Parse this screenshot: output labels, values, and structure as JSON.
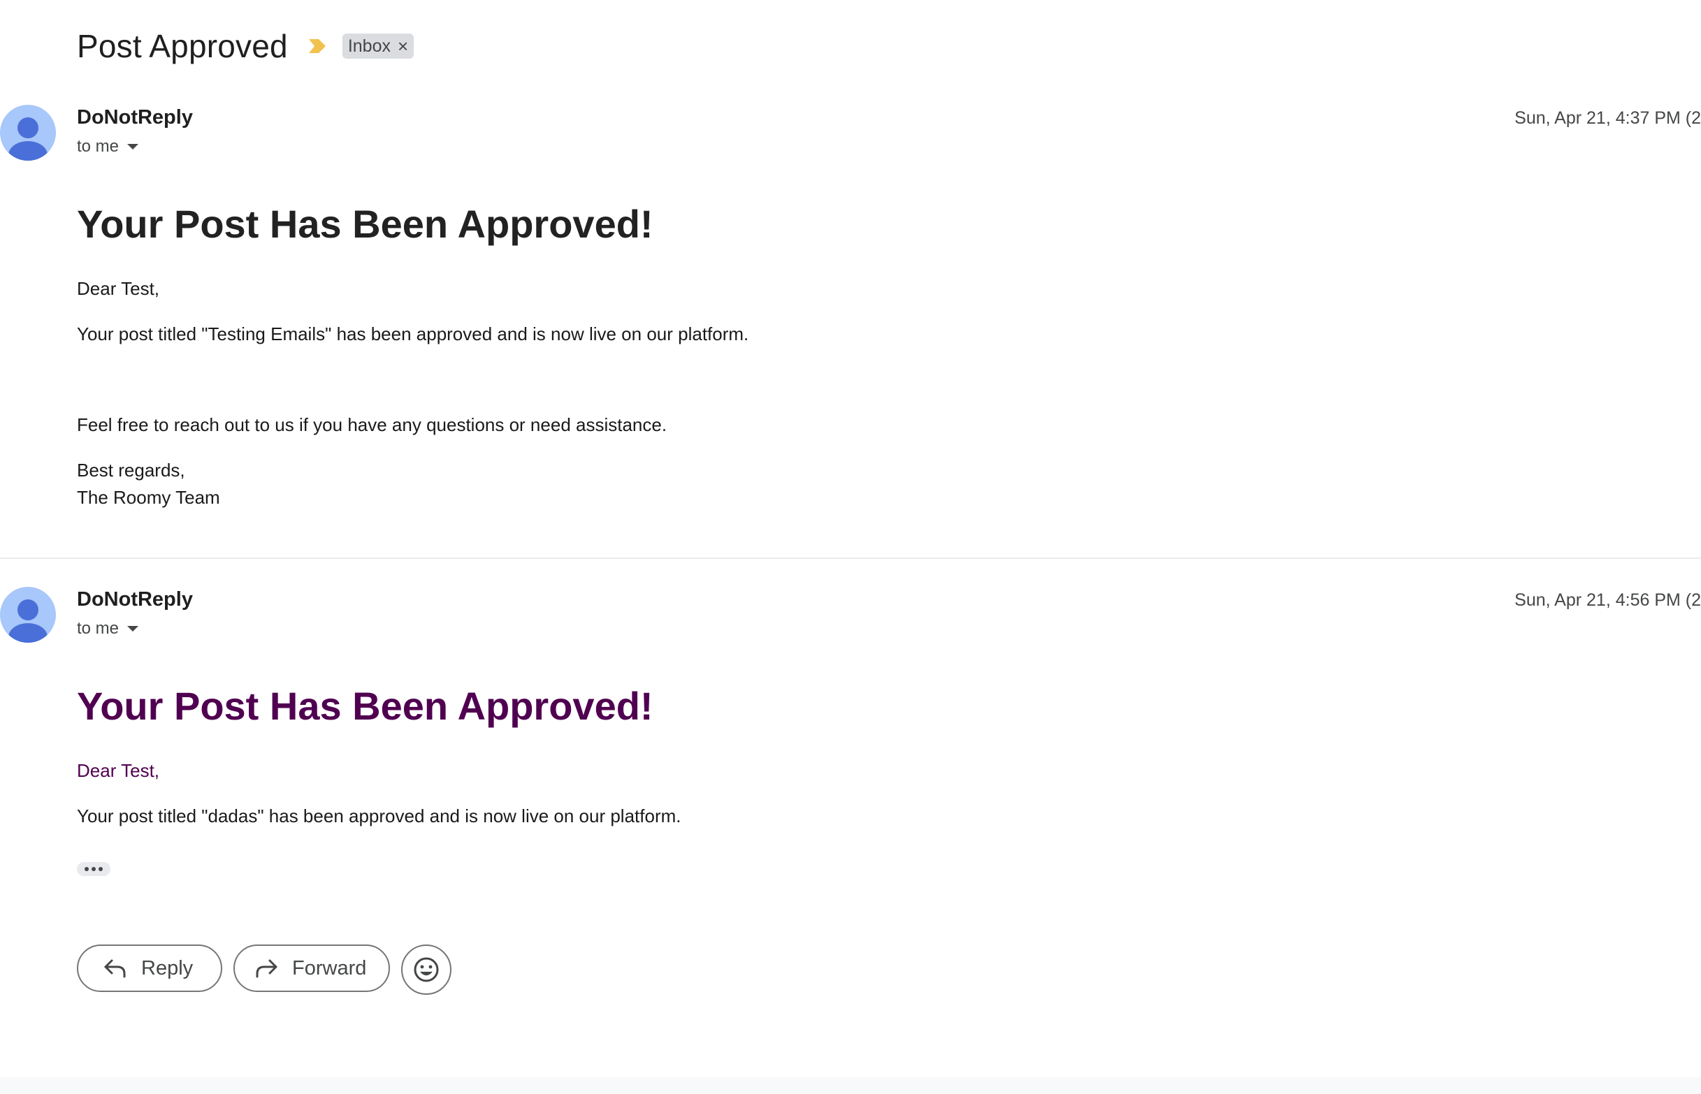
{
  "thread": {
    "subject": "Post Approved",
    "label": "Inbox",
    "label_remove": "×"
  },
  "messages": [
    {
      "sender": "DoNotReply",
      "recipient": "to me",
      "date": "Sun, Apr 21, 4:37 PM (2",
      "heading": "Your Post Has Been Approved!",
      "greeting": "Dear Test,",
      "body": "Your post titled \"Testing Emails\" has been approved and is now live on our platform.",
      "closing": "Feel free to reach out to us if you have any questions or need assistance.",
      "signoff": "Best regards,",
      "signature": "The Roomy Team"
    },
    {
      "sender": "DoNotReply",
      "recipient": "to me",
      "date": "Sun, Apr 21, 4:56 PM (2",
      "heading": "Your Post Has Been Approved!",
      "greeting": "Dear Test,",
      "body": "Your post titled \"dadas\" has been approved and is now live on our platform."
    }
  ],
  "actions": {
    "reply_label": "Reply",
    "forward_label": "Forward"
  },
  "icons": {
    "importance": "importance-marker-icon",
    "avatar": "person-icon",
    "reply": "reply-arrow-icon",
    "forward": "forward-arrow-icon",
    "emoji": "smiley-icon"
  },
  "colors": {
    "importance": "#f2c250",
    "avatar_bg": "#a8c7fa",
    "avatar_fg": "#4a6fd8",
    "trimmed_heading": "#500050"
  }
}
